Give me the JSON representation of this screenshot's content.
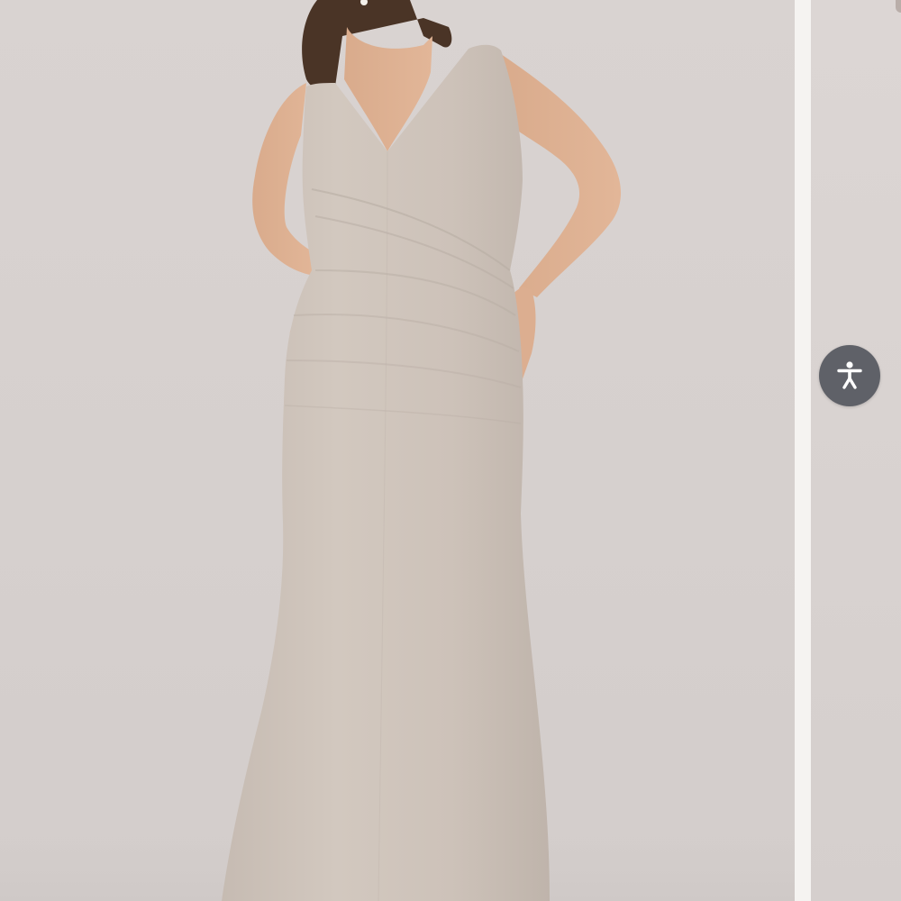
{
  "gallery": {
    "main_image": {
      "alt": "",
      "icon": "dress-photo"
    },
    "next_image": {
      "icon": "next-photo-peek"
    }
  },
  "accessibility": {
    "icon": "accessibility-icon",
    "color": "#5f6168"
  },
  "colors": {
    "backdrop": "#d8d2d0",
    "dress": "#cfc4bb",
    "page_bg": "#f4f2f0"
  }
}
